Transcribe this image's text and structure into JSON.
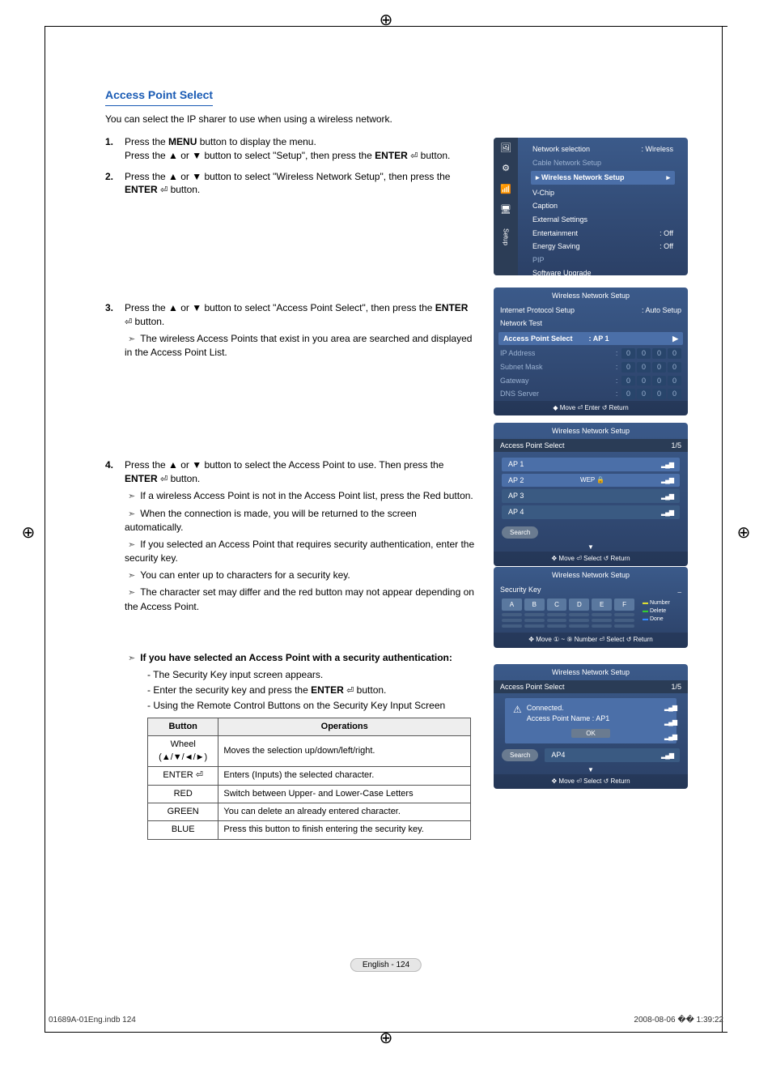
{
  "heading": "Access Point Select",
  "intro": "You can select the IP sharer to use when using a wireless network.",
  "steps": {
    "s1_a": "Press the ",
    "s1_menu": "MENU",
    "s1_b": " button to display the menu.",
    "s1_c": "Press the ▲ or ▼ button to select \"Setup\", then press the ",
    "s1_enter": "ENTER",
    "s1_d": " button.",
    "s2_a": "Press the ▲ or ▼ button to select \"Wireless Network Setup\", then press the ",
    "s2_b": " button.",
    "s3_a": "Press the ▲ or ▼ button to select \"Access Point Select\", then press the ",
    "s3_b": " button.",
    "s3_sub": "The wireless Access Points that exist in you area are searched and displayed in the Access Point List.",
    "s4_a": "Press the ▲ or ▼ button to select the Access Point to use. Then press the ",
    "s4_b": " button.",
    "s4_sub": [
      "If a wireless Access Point is not in the Access Point list, press the Red button.",
      "When the connection is made, you will be returned to the screen automatically.",
      "If you selected an Access Point that requires security authentication, enter the security key.",
      "You can enter up to characters for a security key.",
      "The character set may differ and the red button may not appear depending on the Access Point."
    ]
  },
  "auth": {
    "bullet": "If you have selected an Access Point with a security authentication:",
    "line1": "- The Security Key input screen appears.",
    "line2a": "- Enter the security key and press the ",
    "line2b": " button.",
    "line3": "- Using the Remote Control Buttons on the Security Key Input Screen"
  },
  "table": {
    "head": [
      "Button",
      "Operations"
    ],
    "rows": [
      [
        "Wheel\n(▲/▼/◄/►)",
        "Moves the selection up/down/left/right."
      ],
      [
        "ENTER ⏎",
        "Enters (Inputs) the selected character."
      ],
      [
        "RED",
        "Switch between Upper- and Lower-Case Letters"
      ],
      [
        "GREEN",
        "You can delete an already entered character."
      ],
      [
        "BLUE",
        "Press this button to finish entering the security key."
      ]
    ]
  },
  "osd_menu": {
    "sidebar_label": "Setup",
    "items": [
      {
        "label": "Network selection",
        "value": ": Wireless"
      },
      {
        "label": "Cable Network Setup",
        "dim": true
      },
      {
        "label": "Wireless Network Setup",
        "hl": true
      },
      {
        "label": "V-Chip"
      },
      {
        "label": "Caption"
      },
      {
        "label": "External Settings"
      },
      {
        "label": "Entertainment",
        "value": ": Off"
      },
      {
        "label": "Energy Saving",
        "value": ": Off"
      },
      {
        "label": "PIP",
        "dim": true
      },
      {
        "label": "Software Upgrade"
      }
    ]
  },
  "osd2": {
    "title": "Wireless Network Setup",
    "rows": [
      {
        "label": "Internet Protocol Setup",
        "value": ": Auto Setup"
      },
      {
        "label": "Network Test"
      },
      {
        "label": "Access Point Select",
        "value": ": AP 1",
        "hl": true
      },
      {
        "label": "IP Address",
        "ip": true,
        "dim": true
      },
      {
        "label": "Subnet Mask",
        "ip": true,
        "dim": true
      },
      {
        "label": "Gateway",
        "ip": true,
        "dim": true
      },
      {
        "label": "DNS Server",
        "ip": true,
        "dim": true
      }
    ],
    "foot": "◆ Move     ⏎ Enter     ↺ Return"
  },
  "osd3": {
    "title": "Wireless Network Setup",
    "header": "Access Point Select",
    "counter": "1/5",
    "aps": [
      {
        "name": "AP 1",
        "wep": false
      },
      {
        "name": "AP 2",
        "wep": true,
        "weplabel": "WEP"
      },
      {
        "name": "AP 3",
        "wep": false,
        "dim": true
      },
      {
        "name": "AP 4",
        "wep": false,
        "dim": true
      }
    ],
    "search": "Search",
    "foot": "✥ Move     ⏎ Select     ↺ Return"
  },
  "osd4": {
    "title": "Wireless Network Setup",
    "label": "Security Key",
    "keys": [
      "A",
      "B",
      "C",
      "D",
      "E",
      "F"
    ],
    "legend": [
      "Number",
      "Delete",
      "Done"
    ],
    "foot": "✥ Move   ① ~ ⑨ Number   ⏎ Select   ↺ Return"
  },
  "osd5": {
    "title": "Wireless Network Setup",
    "header": "Access Point Select",
    "counter": "1/5",
    "msg1": "Connected.",
    "msg2": "Access Point Name : AP1",
    "ok": "OK",
    "search": "Search",
    "ap4": "AP4",
    "foot": "✥ Move     ⏎ Select     ↺ Return"
  },
  "footer": {
    "page": "English - 124",
    "file": "01689A-01Eng.indb   124",
    "date": "2008-08-06   �� 1:39:22"
  }
}
